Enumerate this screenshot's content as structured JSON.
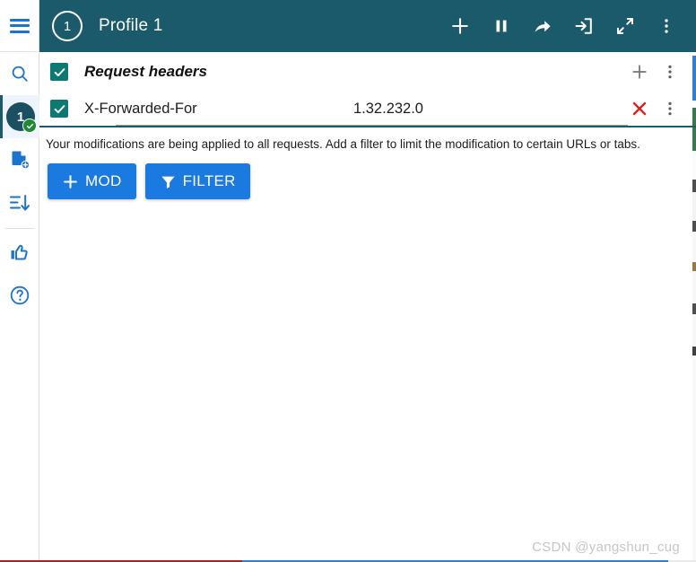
{
  "rail": {
    "menu": {
      "icon": "hamburger-icon"
    },
    "items": [
      {
        "name": "search",
        "icon": "search-icon",
        "selected": false
      },
      {
        "name": "profile-1",
        "icon": "profile-badge-icon",
        "label": "1",
        "status": "active",
        "selected": true
      },
      {
        "name": "new-profile",
        "icon": "document-plus-icon",
        "selected": false
      },
      {
        "name": "sort-list",
        "icon": "sort-descending-icon",
        "selected": false
      },
      {
        "name": "rate",
        "icon": "thumbs-up-icon",
        "selected": false
      },
      {
        "name": "help",
        "icon": "question-circle-icon",
        "selected": false
      }
    ]
  },
  "titlebar": {
    "profile_number": "1",
    "profile_name": "Profile 1",
    "background": "#1b5a6b",
    "actions": [
      {
        "name": "add-profile",
        "icon": "plus-icon",
        "title": "Add"
      },
      {
        "name": "pause",
        "icon": "pause-icon",
        "title": "Pause"
      },
      {
        "name": "share",
        "icon": "share-arrow-icon",
        "title": "Share"
      },
      {
        "name": "import",
        "icon": "import-login-icon",
        "title": "Import"
      },
      {
        "name": "expand",
        "icon": "expand-diagonal-icon",
        "title": "Expand"
      },
      {
        "name": "more",
        "icon": "more-vertical-icon",
        "title": "More"
      }
    ]
  },
  "section": {
    "title": "Request headers",
    "checked": true,
    "checkbox_color": "#0c7a73",
    "add_label": "+",
    "add_icon": "plus-icon",
    "more_icon": "more-vertical-icon"
  },
  "header_row": {
    "checked": true,
    "name": "X-Forwarded-For",
    "value": "1.32.232.0",
    "delete_icon": "close-x-icon",
    "delete_color": "#e01b1b",
    "more_icon": "more-vertical-icon"
  },
  "note": "Your modifications are being applied to all requests. Add a filter to limit the modification to certain URLs or tabs.",
  "buttons": [
    {
      "name": "add-mod",
      "label": "MOD",
      "icon": "plus-icon",
      "color": "#1b7ae0"
    },
    {
      "name": "add-filter",
      "label": "FILTER",
      "icon": "funnel-filter-icon",
      "color": "#1b7ae0"
    }
  ],
  "watermark": "CSDN @yangshun_cug"
}
